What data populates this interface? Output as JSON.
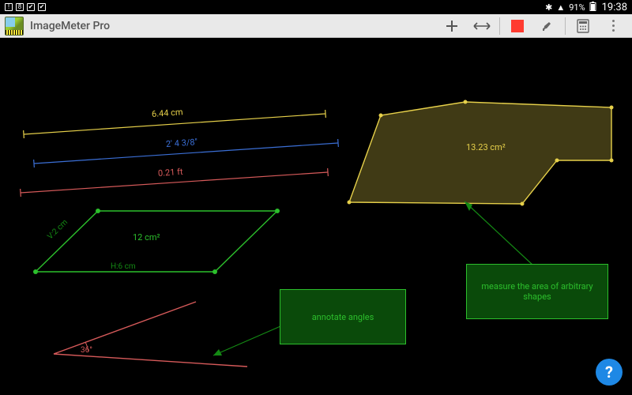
{
  "status_bar": {
    "left_badges": [
      "!",
      "8",
      "✔",
      "✔"
    ],
    "bluetooth": "✱",
    "signal": "▲",
    "battery_pct": "91%",
    "clock": "19:38"
  },
  "app": {
    "title": "ImageMeter Pro"
  },
  "toolbar": {
    "add": "+",
    "dimension": "↔",
    "color_swatch": "#ff3b30",
    "brush": "brush",
    "calc": "calc",
    "overflow": "⋮"
  },
  "shapes": {
    "yellow_line_label": "6.44 cm",
    "blue_line_label": "2'  4 3/8\"",
    "red_line_label": "0.21 ft",
    "green_area_label": "12 cm²",
    "green_v_label": "V:2 cm",
    "green_h_label": "H:6 cm",
    "yellow_area_label": "13.23 cm²",
    "angle_label": "36°"
  },
  "notes": {
    "angles": "annotate angles",
    "area": "measure the area of arbitrary shapes"
  },
  "help": "?"
}
